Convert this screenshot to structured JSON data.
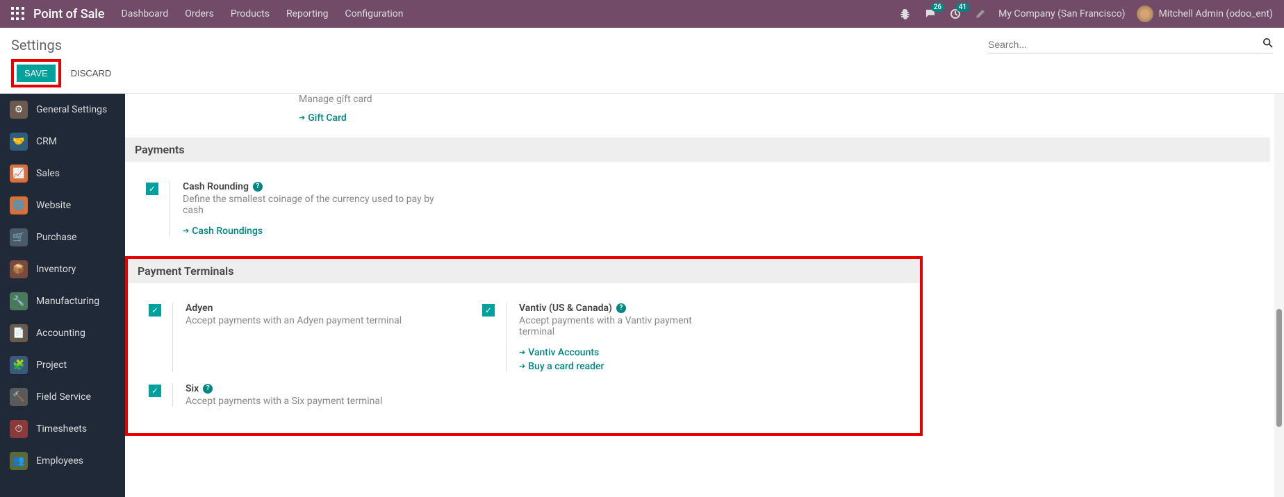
{
  "navbar": {
    "app_title": "Point of Sale",
    "menu": [
      "Dashboard",
      "Orders",
      "Products",
      "Reporting",
      "Configuration"
    ],
    "chat_badge": "26",
    "activity_badge": "41",
    "company": "My Company (San Francisco)",
    "user": "Mitchell Admin (odoo_ent)"
  },
  "subheader": {
    "title": "Settings",
    "search_placeholder": "Search...",
    "save_label": "SAVE",
    "discard_label": "DISCARD"
  },
  "sidebar": {
    "items": [
      {
        "label": "General Settings",
        "color": "#6b5a4d"
      },
      {
        "label": "CRM",
        "color": "#2f5d7c"
      },
      {
        "label": "Sales",
        "color": "#d96f3a"
      },
      {
        "label": "Website",
        "color": "#d96f3a"
      },
      {
        "label": "Purchase",
        "color": "#4a5a6a"
      },
      {
        "label": "Inventory",
        "color": "#7a4a3a"
      },
      {
        "label": "Manufacturing",
        "color": "#4a7a5a"
      },
      {
        "label": "Accounting",
        "color": "#6a5a4a"
      },
      {
        "label": "Project",
        "color": "#3a5a7a"
      },
      {
        "label": "Field Service",
        "color": "#5a5a5a"
      },
      {
        "label": "Timesheets",
        "color": "#8a3a3a"
      },
      {
        "label": "Employees",
        "color": "#5a6a3a"
      }
    ]
  },
  "content": {
    "gift_card": {
      "desc": "Manage gift card",
      "link": "Gift Card"
    },
    "payments_title": "Payments",
    "cash_rounding": {
      "title": "Cash Rounding",
      "desc": "Define the smallest coinage of the currency used to pay by cash",
      "link": "Cash Roundings"
    },
    "terminals_title": "Payment Terminals",
    "adyen": {
      "title": "Adyen",
      "desc": "Accept payments with an Adyen payment terminal"
    },
    "vantiv": {
      "title": "Vantiv (US & Canada)",
      "desc": "Accept payments with a Vantiv payment terminal",
      "link1": "Vantiv Accounts",
      "link2": "Buy a card reader"
    },
    "six": {
      "title": "Six",
      "desc": "Accept payments with a Six payment terminal"
    }
  }
}
